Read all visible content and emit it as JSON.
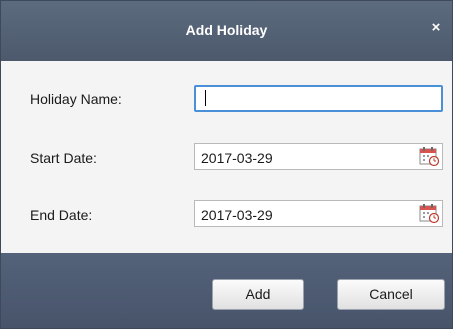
{
  "dialog": {
    "title": "Add Holiday",
    "close_glyph": "×"
  },
  "form": {
    "holiday_name": {
      "label": "Holiday Name:",
      "value": ""
    },
    "start_date": {
      "label": "Start Date:",
      "value": "2017-03-29",
      "icon": "calendar-icon"
    },
    "end_date": {
      "label": "End Date:",
      "value": "2017-03-29",
      "icon": "calendar-icon"
    }
  },
  "footer": {
    "add_label": "Add",
    "cancel_label": "Cancel"
  },
  "colors": {
    "titlebar": "#55637a",
    "footer": "#4f5c72",
    "focus": "#4a90d9"
  }
}
